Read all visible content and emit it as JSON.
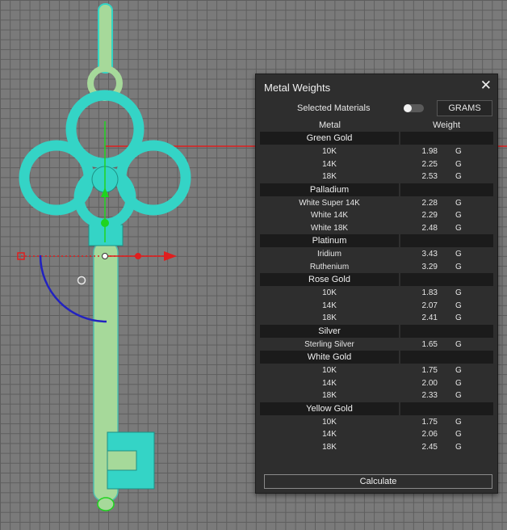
{
  "panel": {
    "title": "Metal Weights",
    "selected_materials_label": "Selected Materials",
    "units_button": "GRAMS",
    "column_metal": "Metal",
    "column_weight": "Weight",
    "calculate_label": "Calculate"
  },
  "unit_symbol": "G",
  "groups": [
    {
      "name": "Green Gold",
      "items": [
        {
          "karat": "10K",
          "weight": "1.98"
        },
        {
          "karat": "14K",
          "weight": "2.25"
        },
        {
          "karat": "18K",
          "weight": "2.53"
        }
      ]
    },
    {
      "name": "Palladium",
      "items": [
        {
          "karat": "White Super 14K",
          "weight": "2.28"
        },
        {
          "karat": "White 14K",
          "weight": "2.29"
        },
        {
          "karat": "White 18K",
          "weight": "2.48"
        }
      ]
    },
    {
      "name": "Platinum",
      "items": [
        {
          "karat": "Iridium",
          "weight": "3.43"
        },
        {
          "karat": "Ruthenium",
          "weight": "3.29"
        }
      ]
    },
    {
      "name": "Rose Gold",
      "items": [
        {
          "karat": "10K",
          "weight": "1.83"
        },
        {
          "karat": "14K",
          "weight": "2.07"
        },
        {
          "karat": "18K",
          "weight": "2.41"
        }
      ]
    },
    {
      "name": "Silver",
      "items": [
        {
          "karat": "Sterling Silver",
          "weight": "1.65"
        }
      ]
    },
    {
      "name": "White Gold",
      "items": [
        {
          "karat": "10K",
          "weight": "1.75"
        },
        {
          "karat": "14K",
          "weight": "2.00"
        },
        {
          "karat": "18K",
          "weight": "2.33"
        }
      ]
    },
    {
      "name": "Yellow Gold",
      "items": [
        {
          "karat": "10K",
          "weight": "1.75"
        },
        {
          "karat": "14K",
          "weight": "2.06"
        },
        {
          "karat": "18K",
          "weight": "2.45"
        }
      ]
    }
  ],
  "colors": {
    "viewport_bg": "#7a7a7a",
    "grid": "#5e5e5e",
    "gem_cyan": "#34d4c6",
    "shaft_green": "#a6d99a",
    "axis_red": "#e01e1e",
    "axis_green": "#1fd41f",
    "rotate_blue": "#2222c0"
  }
}
